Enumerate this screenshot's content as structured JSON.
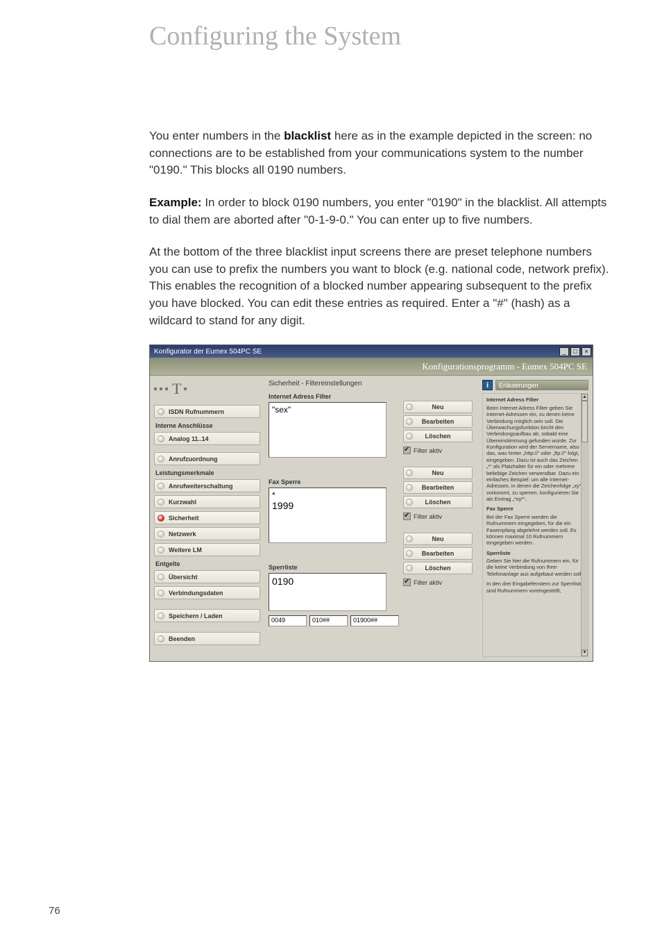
{
  "page": {
    "title": "Configuring the System",
    "number": "76"
  },
  "body": {
    "p1a": "You enter numbers in the ",
    "p1b": "blacklist",
    "p1c": " here as in the example depicted in the screen: no connections are to be established from your communications system to the number \"0190.\" This blocks all 0190 numbers.",
    "p2a": "Example:",
    "p2b": " In order to block 0190 numbers, you enter \"0190\" in the blacklist. All attempts to dial them are aborted after \"0-1-9-0.\" You can enter up to five numbers.",
    "p3": "At the bottom of the three blacklist input screens there are preset telephone numbers you can use to prefix the numbers you want to block (e.g. national code, network prefix).",
    "p4": "This enables the recognition of a blocked number appearing subsequent to the prefix you have blocked. You can edit these entries as required. Enter a \"#\" (hash) as a wildcard to stand for any digit."
  },
  "win": {
    "title": "Konfigurator der Eumex 504PC SE",
    "wbtns": {
      "min": "_",
      "max": "□",
      "close": "×"
    },
    "banner": "Konfigurationsprogramm - Eumex 504PC SE",
    "nav": {
      "h1": "ISDN Rufnummern",
      "h2": "Interne Anschlüsse",
      "items2": [
        "Analog 11..14"
      ],
      "items3": [
        "Anrufzuordnung"
      ],
      "h3": "Leistungsmerkmale",
      "items4": [
        "Anrufweiterschaltung",
        "Kurzwahl",
        "Sicherheit",
        "Netzwerk",
        "Weitere LM"
      ],
      "h4": "Entgelte",
      "items5": [
        "Übersicht",
        "Verbindungsdaten"
      ],
      "items6": [
        "Speichern / Laden"
      ],
      "items7": [
        "Beenden"
      ]
    },
    "center": {
      "breadcrumb": "Sicherheit - Filtereinstellungen",
      "grp1": {
        "label": "Internet Adress Filter",
        "value": "\"sex\""
      },
      "grp2": {
        "label": "Fax Sperre",
        "value1": "*",
        "value2": "1999"
      },
      "grp3": {
        "label": "Sperrliste",
        "value": "0190"
      },
      "btns": {
        "neu": "Neu",
        "bearb": "Bearbeiten",
        "loesch": "Löschen"
      },
      "filter_aktiv": "Filter aktiv",
      "prefill": {
        "a": "0049",
        "b": "010##",
        "c": "01900##"
      }
    },
    "help": {
      "title": "Erläuterungen",
      "h1": "Internet Adress Filter",
      "p1": "Beim Internet Adress Filter geben Sie Internet-Adressen ein, zu denen keine Verbindung möglich sein soll. Die Überwachungsfunktion bricht den Verbindungsaufbau ab, sobald eine Übereinstimmung gefunden wurde. Zur Konfiguration wird der Servername, also das, was hinter „http://“ oder „ftp://“ folgt, eingegeben. Dazu ist auch das Zeichen „*“ als Platzhalter für ein oder mehrere beliebige Zeichen verwendbar. Dazu ein einfaches Beispiel: um alle Internet-Adressen, in denen die Zeichenfolge „xy“ vorkommt, zu sperren, konfigurieren Sie als Eintrag „*xy*“.",
      "h2": "Fax Sperre",
      "p2": "Bei der Fax Sperre werden die Rufnummern eingegeben, für die ein Faxempfang abgelehnt werden soll. Es können maximal 10 Rufnummern eingegeben werden.",
      "h3": "Sperrliste",
      "p3": "Geben Sie hier die Rufnummern ein, für die keine Verbindung von Ihrer Telefonanlage aus aufgebaut werden soll.",
      "p4": "In den drei Eingabefenstern zur Sperrliste sind Rufnummern voreingestellt,"
    }
  }
}
